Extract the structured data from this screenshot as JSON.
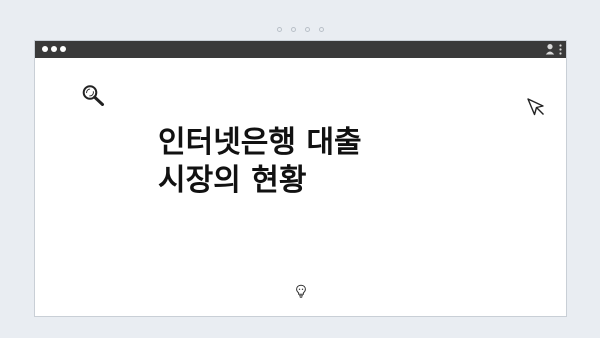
{
  "icons": {
    "outer": "pagination-dots",
    "window": "window-control-dots",
    "profile": "profile-icon",
    "menu": "kebab-menu-icon",
    "search": "search-icon",
    "cursor": "cursor-icon",
    "bulb": "lightbulb-icon"
  },
  "content": {
    "heading_line1": "인터넷은행 대출",
    "heading_line2": "시장의 현황"
  },
  "colors": {
    "background": "#e9edf2",
    "titlebar": "#3a3a3a",
    "window": "#ffffff",
    "text": "#111111"
  }
}
